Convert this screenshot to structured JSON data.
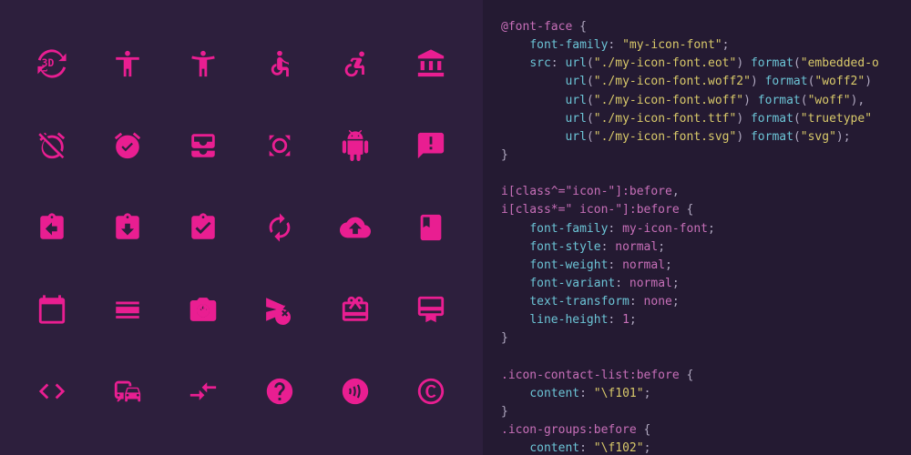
{
  "icons": [
    [
      "3d-rotation",
      "accessibility",
      "accessibility-new",
      "accessible",
      "accessible-forward",
      "account-balance"
    ],
    [
      "alarm-off",
      "alarm-on",
      "all-inbox",
      "all-out",
      "android",
      "announcement"
    ],
    [
      "assignment-return",
      "assignment-returned",
      "assignment-turned-in",
      "autorenew",
      "backup",
      "book"
    ],
    [
      "calendar-today",
      "calendar-view-day",
      "camera-enhance",
      "cancel-schedule-send",
      "card-giftcard",
      "card-membership"
    ],
    [
      "code",
      "commute",
      "compare-arrows",
      "help",
      "contactless",
      "copyright"
    ]
  ],
  "code": {
    "font_face_at": "@font-face",
    "font_family_prop": "font-family",
    "font_family_val": "\"my-icon-font\"",
    "src_prop": "src",
    "src_lines": [
      {
        "url": "\"./my-icon-font.eot\"",
        "format": "\"embedded-o"
      },
      {
        "url": "\"./my-icon-font.woff2\"",
        "format": "\"woff2\""
      },
      {
        "url": "\"./my-icon-font.woff\"",
        "format": "\"woff\""
      },
      {
        "url": "\"./my-icon-font.ttf\"",
        "format": "\"truetype\""
      },
      {
        "url": "\"./my-icon-font.svg\"",
        "format": "\"svg\""
      }
    ],
    "selector1": "i[class^=\"icon-\"]:before",
    "selector2": "i[class*=\" icon-\"]:before",
    "rules": [
      {
        "prop": "font-family",
        "val": "my-icon-font"
      },
      {
        "prop": "font-style",
        "val": "normal"
      },
      {
        "prop": "font-weight",
        "val": "normal"
      },
      {
        "prop": "font-variant",
        "val": "normal"
      },
      {
        "prop": "text-transform",
        "val": "none"
      },
      {
        "prop": "line-height",
        "val": "1"
      }
    ],
    "class_rules": [
      {
        "sel": ".icon-contact-list:before",
        "prop": "content",
        "val": "\"\\f101\""
      },
      {
        "sel": ".icon-groups:before",
        "prop": "content",
        "val": "\"\\f102\""
      }
    ]
  }
}
